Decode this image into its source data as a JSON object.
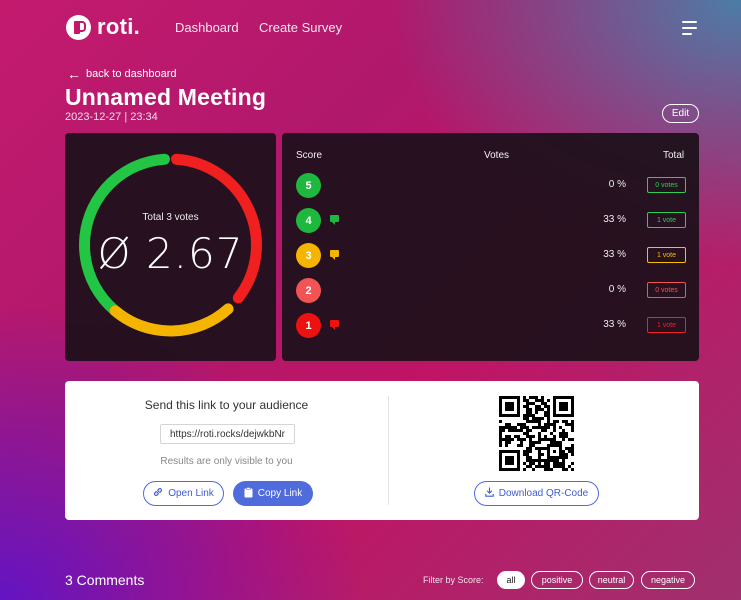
{
  "header": {
    "logo_text": "roti.",
    "nav": [
      "Dashboard",
      "Create Survey"
    ]
  },
  "page": {
    "back_label": "back to dashboard",
    "title": "Unnamed Meeting",
    "datetime": "2023-12-27 | 23:34",
    "edit_label": "Edit"
  },
  "gauge": {
    "label": "Total 3 votes",
    "value": "Ø 2.67",
    "segments": [
      {
        "score": "positive",
        "color": "#22c544",
        "fraction": 0.33
      },
      {
        "score": "neutral",
        "color": "#f5b400",
        "fraction": 0.33
      },
      {
        "score": "negative",
        "color": "#f02020",
        "fraction": 0.33
      }
    ]
  },
  "votes": {
    "headers": {
      "score": "Score",
      "votes": "Votes",
      "total": "Total"
    },
    "rows": [
      {
        "score": "5",
        "color": "#1fb83e",
        "percent": "0 %",
        "badge": "0 votes",
        "badge_color": "#2ecc55",
        "has_comment": false
      },
      {
        "score": "4",
        "color": "#1fb83e",
        "percent": "33 %",
        "badge": "1 vote",
        "badge_color": "#2ecc55",
        "has_comment": true
      },
      {
        "score": "3",
        "color": "#f5b400",
        "percent": "33 %",
        "badge": "1 vote",
        "badge_color": "#f5c000",
        "has_comment": true
      },
      {
        "score": "2",
        "color": "#f25353",
        "percent": "0 %",
        "badge": "0 votes",
        "badge_color": "#f25353",
        "has_comment": false
      },
      {
        "score": "1",
        "color": "#ee1111",
        "percent": "33 %",
        "badge": "1 vote",
        "badge_color": "#ee2222",
        "has_comment": true
      }
    ]
  },
  "share": {
    "title": "Send this link to your audience",
    "url": "https://roti.rocks/dejwkbNr",
    "note": "Results are only visible to you",
    "open_label": "Open Link",
    "copy_label": "Copy Link",
    "download_label": "Download QR-Code"
  },
  "comments": {
    "title": "3 Comments",
    "filter_label": "Filter by Score:",
    "filters": [
      "all",
      "positive",
      "neutral",
      "negative"
    ],
    "active_filter": "all"
  },
  "colors": {
    "accent": "#4f6bdc",
    "brand": "#c4176c"
  }
}
